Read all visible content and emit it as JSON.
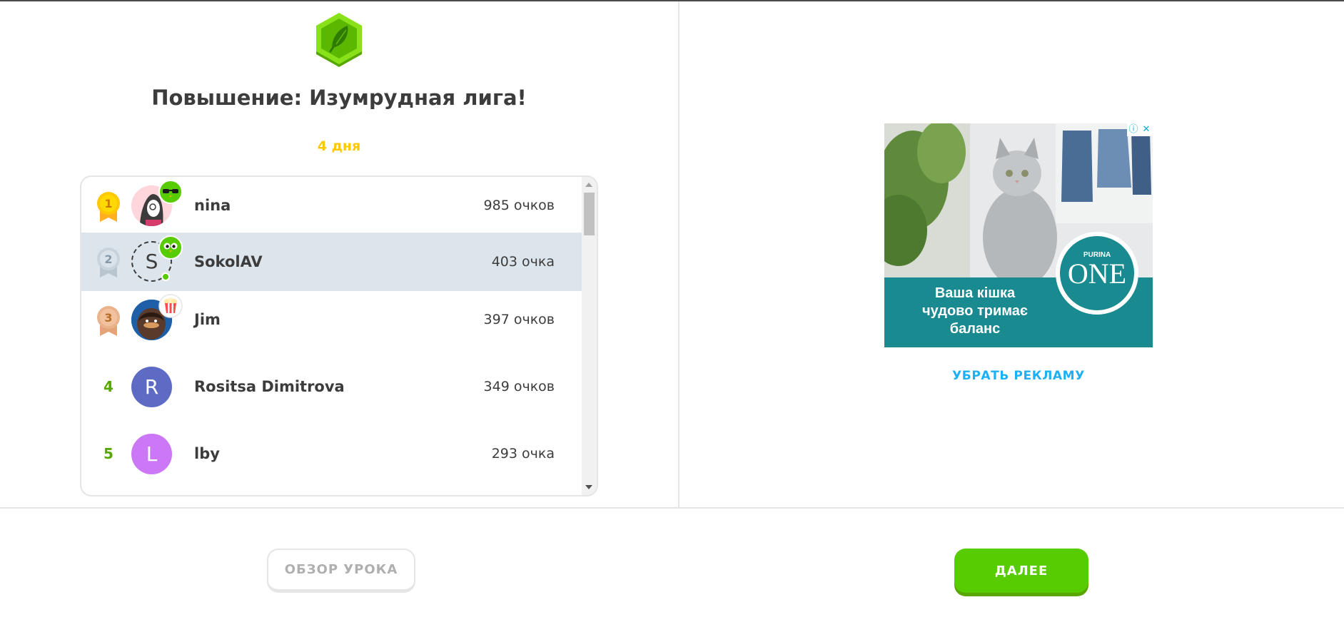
{
  "header": {
    "title": "Повышение: Изумрудная лига!",
    "days_left": "4 дня"
  },
  "leaderboard": {
    "rows": [
      {
        "rank": "1",
        "name": "nina",
        "score": "985 очков",
        "medal": "gold",
        "badge": "sunglasses-owl-icon"
      },
      {
        "rank": "2",
        "name": "SokolAV",
        "score": "403 очка",
        "medal": "silver",
        "initial": "S",
        "badge": "owl-icon",
        "current_user": true
      },
      {
        "rank": "3",
        "name": "Jim",
        "score": "397 очков",
        "medal": "bronze",
        "badge": "popcorn-icon"
      },
      {
        "rank": "4",
        "name": "Rositsa Dimitrova",
        "score": "349 очков",
        "initial": "R",
        "avatar_color": "#5d6bc4"
      },
      {
        "rank": "5",
        "name": "lby",
        "score": "293 очка",
        "initial": "L",
        "avatar_color": "#cc77f5"
      }
    ]
  },
  "ad": {
    "headline": "Ваша кішка чудово тримає баланс",
    "brand": "ONE",
    "brand_maker": "PURINA",
    "remove_ads": "УБРАТЬ РЕКЛАМУ"
  },
  "footer": {
    "review_label": "ОБЗОР УРОКА",
    "continue_label": "ДАЛЕЕ"
  },
  "colors": {
    "accent_green": "#58cc02",
    "gold": "#ffc800",
    "link_blue": "#1cb0f6",
    "highlight_row": "#dde5ec"
  }
}
